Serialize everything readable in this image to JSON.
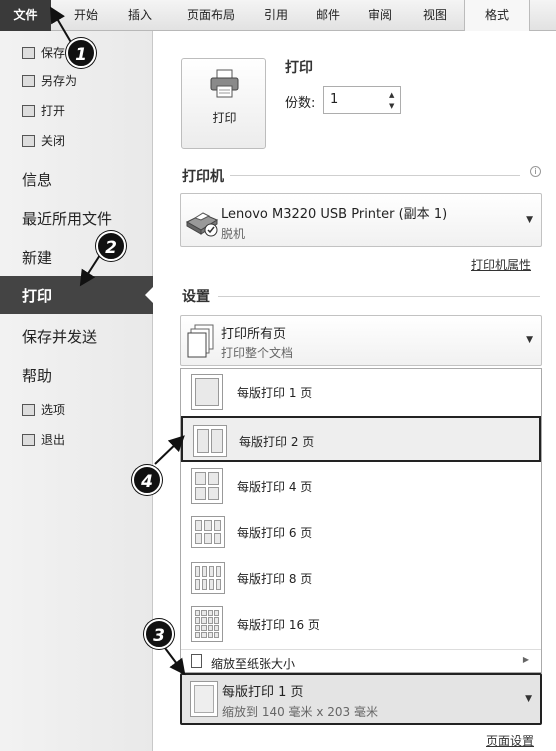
{
  "ribbon": {
    "tabs": [
      "文件",
      "开始",
      "插入",
      "页面布局",
      "引用",
      "邮件",
      "审阅",
      "视图",
      "格式"
    ]
  },
  "sidebar": {
    "small_items_top": [
      "保存",
      "另存为",
      "打开",
      "关闭"
    ],
    "big_items": [
      "信息",
      "最近所用文件",
      "新建"
    ],
    "active_item": "打印",
    "big_items_bottom": [
      "保存并发送",
      "帮助"
    ],
    "small_items_bottom": [
      "选项",
      "退出"
    ]
  },
  "print": {
    "title": "打印",
    "button_label": "打印",
    "copies_label": "份数:",
    "copies_value": "1"
  },
  "printer": {
    "title": "打印机",
    "name": "Lenovo M3220 USB Printer (副本 1)",
    "status": "脱机",
    "properties_link": "打印机属性"
  },
  "settings": {
    "title": "设置",
    "range_main": "打印所有页",
    "range_sub": "打印整个文档",
    "pages_per_sheet_options": [
      "每版打印 1 页",
      "每版打印 2 页",
      "每版打印 4 页",
      "每版打印 6 页",
      "每版打印 8 页",
      "每版打印 16 页"
    ],
    "selected_option_index": 1,
    "scale_label": "缩放至纸张大小",
    "current_main": "每版打印 1 页",
    "current_sub": "缩放到 140 毫米 x 203 毫米",
    "page_setup_link": "页面设置"
  },
  "annotations": [
    "1",
    "2",
    "3",
    "4"
  ]
}
